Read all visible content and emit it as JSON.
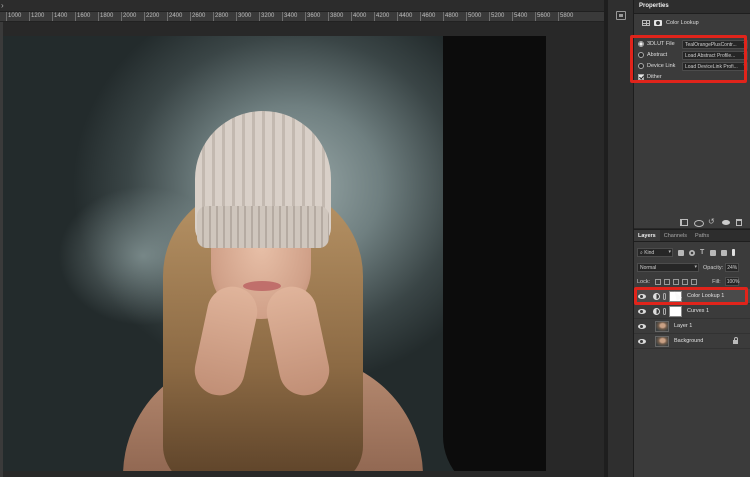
{
  "ruler": {
    "labels": [
      "1000",
      "1200",
      "1400",
      "1600",
      "1800",
      "2000",
      "2200",
      "2400",
      "2600",
      "2800",
      "3000",
      "3200",
      "3400",
      "3600",
      "3800",
      "4000",
      "4200",
      "4400",
      "4600",
      "4800",
      "5000",
      "5200",
      "5400",
      "5600",
      "5800"
    ]
  },
  "properties": {
    "title": "Properties",
    "subtitle": "Color Lookup",
    "rows": [
      {
        "label": "3DLUT File",
        "value": "TealOrangePlusContr...",
        "selected": true
      },
      {
        "label": "Abstract",
        "value": "Load Abstract Profile...",
        "selected": false
      },
      {
        "label": "Device Link",
        "value": "Load DeviceLink Profi...",
        "selected": false
      }
    ],
    "dither_label": "Dither",
    "dither_checked": true
  },
  "layers_panel": {
    "tabs": [
      "Layers",
      "Channels",
      "Paths"
    ],
    "filter": "Kind",
    "blend_mode": "Normal",
    "opacity_label": "Opacity:",
    "opacity_value": "24%",
    "lock_label": "Lock:",
    "fill_label": "Fill:",
    "fill_value": "100%",
    "layers": [
      {
        "name": "Color Lookup 1",
        "type": "adjustment",
        "selected": true
      },
      {
        "name": "Curves 1",
        "type": "adjustment",
        "selected": false
      },
      {
        "name": "Layer 1",
        "type": "pixel",
        "selected": false
      },
      {
        "name": "Background",
        "type": "pixel",
        "locked": true,
        "selected": false
      }
    ]
  },
  "colors": {
    "highlight": "#e0241b",
    "panel_bg": "#3b3b3b",
    "selected_layer": "#4a4a4a"
  }
}
